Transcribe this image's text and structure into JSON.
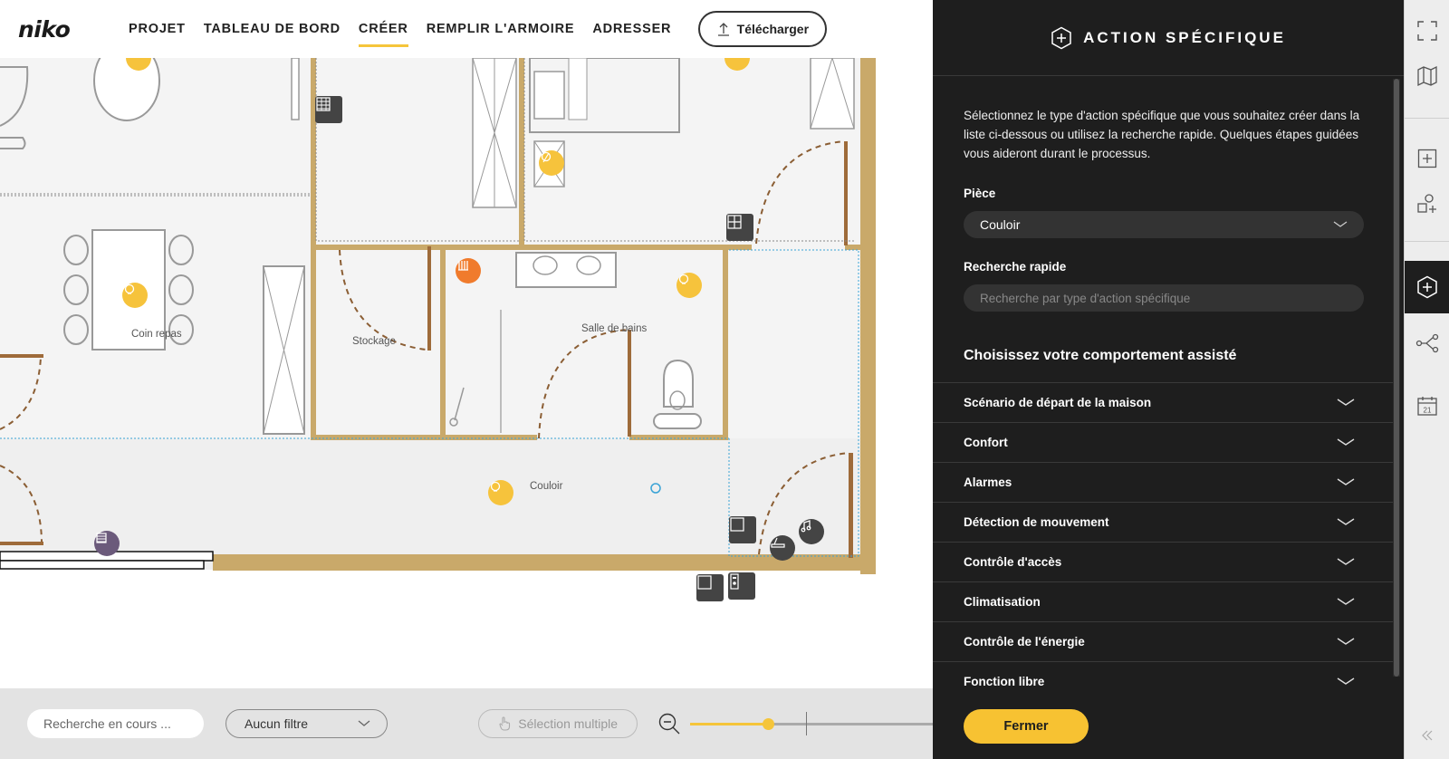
{
  "brand": "niko",
  "nav": {
    "items": [
      "PROJET",
      "TABLEAU DE BORD",
      "CRÉER",
      "REMPLIR L'ARMOIRE",
      "ADRESSER"
    ],
    "active_index": 2,
    "download_label": "Télécharger"
  },
  "floorplan": {
    "rooms": [
      "Coin repas",
      "Stockage",
      "Salle de bains",
      "Couloir"
    ]
  },
  "bottom": {
    "search_placeholder": "Recherche en cours ...",
    "filter_value": "Aucun filtre",
    "multi_select_label": "Sélection multiple",
    "zoom_level": 0.32
  },
  "panel": {
    "title": "ACTION SPÉCIFIQUE",
    "description": "Sélectionnez le type d'action spécifique que vous souhaitez créer dans la liste ci-dessous ou utilisez la recherche rapide. Quelques étapes guidées vous aideront durant le processus.",
    "room_label": "Pièce",
    "room_value": "Couloir",
    "quick_search_label": "Recherche rapide",
    "quick_search_placeholder": "Recherche par type d'action spécifique",
    "section_title": "Choisissez votre comportement assisté",
    "accordion": [
      "Scénario de départ de la maison",
      "Confort",
      "Alarmes",
      "Détection de mouvement",
      "Contrôle d'accès",
      "Climatisation",
      "Contrôle de l'énergie",
      "Fonction libre"
    ],
    "close_label": "Fermer"
  },
  "sidebar": {
    "calendar_day": "21"
  },
  "colors": {
    "accent": "#f5c53a",
    "panel_bg": "#1e1e1e",
    "wall": "#c9a96a"
  }
}
